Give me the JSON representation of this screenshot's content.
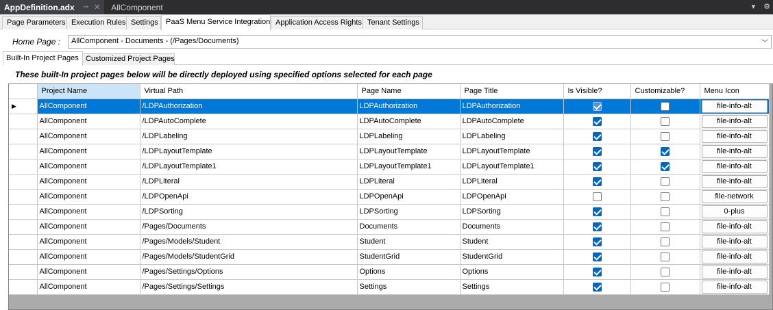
{
  "doc_tabs": {
    "active": "AppDefinition.adx",
    "pin_icon": "pin-icon",
    "close_icon": "close-icon",
    "inactive": "AllComponent"
  },
  "main_tabs": [
    "Page Parameters",
    "Execution Rules",
    "Settings",
    "PaaS Menu Service Integration",
    "Application Access Rights",
    "Tenant Settings"
  ],
  "home_page": {
    "label": "Home Page :",
    "value": "AllComponent - Documents - (/Pages/Documents)"
  },
  "sub_tabs": [
    "Built-In Project Pages",
    "Customized Project Pages"
  ],
  "info_text": "These built-In project pages below will be directly deployed using specified options selected for each page",
  "grid": {
    "columns": [
      "Project Name",
      "Virtual Path",
      "Page Name",
      "Page Title",
      "Is Visible?",
      "Customizable?",
      "Menu Icon"
    ],
    "rows": [
      {
        "project": "AllComponent",
        "path": "/LDPAuthorization",
        "name": "LDPAuthorization",
        "title": "LDPAuthorization",
        "visible": true,
        "custom": false,
        "icon": "file-info-alt"
      },
      {
        "project": "AllComponent",
        "path": "/LDPAutoComplete",
        "name": "LDPAutoComplete",
        "title": "LDPAutoComplete",
        "visible": true,
        "custom": false,
        "icon": "file-info-alt"
      },
      {
        "project": "AllComponent",
        "path": "/LDPLabeling",
        "name": "LDPLabeling",
        "title": "LDPLabeling",
        "visible": true,
        "custom": false,
        "icon": "file-info-alt"
      },
      {
        "project": "AllComponent",
        "path": "/LDPLayoutTemplate",
        "name": "LDPLayoutTemplate",
        "title": "LDPLayoutTemplate",
        "visible": true,
        "custom": true,
        "icon": "file-info-alt"
      },
      {
        "project": "AllComponent",
        "path": "/LDPLayoutTemplate1",
        "name": "LDPLayoutTemplate1",
        "title": "LDPLayoutTemplate1",
        "visible": true,
        "custom": true,
        "icon": "file-info-alt"
      },
      {
        "project": "AllComponent",
        "path": "/LDPLiteral",
        "name": "LDPLiteral",
        "title": "LDPLiteral",
        "visible": true,
        "custom": false,
        "icon": "file-info-alt"
      },
      {
        "project": "AllComponent",
        "path": "/LDPOpenApi",
        "name": "LDPOpenApi",
        "title": "LDPOpenApi",
        "visible": false,
        "custom": false,
        "icon": "file-network"
      },
      {
        "project": "AllComponent",
        "path": "/LDPSorting",
        "name": "LDPSorting",
        "title": "LDPSorting",
        "visible": true,
        "custom": false,
        "icon": "0-plus"
      },
      {
        "project": "AllComponent",
        "path": "/Pages/Documents",
        "name": "Documents",
        "title": "Documents",
        "visible": true,
        "custom": false,
        "icon": "file-info-alt"
      },
      {
        "project": "AllComponent",
        "path": "/Pages/Models/Student",
        "name": "Student",
        "title": "Student",
        "visible": true,
        "custom": false,
        "icon": "file-info-alt"
      },
      {
        "project": "AllComponent",
        "path": "/Pages/Models/StudentGrid",
        "name": "StudentGrid",
        "title": "StudentGrid",
        "visible": true,
        "custom": false,
        "icon": "file-info-alt"
      },
      {
        "project": "AllComponent",
        "path": "/Pages/Settings/Options",
        "name": "Options",
        "title": "Options",
        "visible": true,
        "custom": false,
        "icon": "file-info-alt"
      },
      {
        "project": "AllComponent",
        "path": "/Pages/Settings/Settings",
        "name": "Settings",
        "title": "Settings",
        "visible": true,
        "custom": false,
        "icon": "file-info-alt"
      }
    ]
  },
  "colors": {
    "selection": "#0078d7",
    "checkbox": "#0067c0",
    "title_bar": "#2d2d30"
  }
}
